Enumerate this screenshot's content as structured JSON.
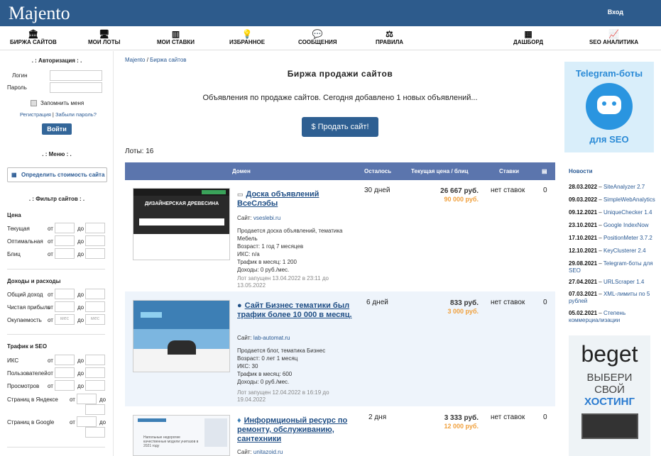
{
  "header": {
    "logo": "Majento",
    "login": "Вход"
  },
  "nav": [
    {
      "icon": "bank-icon",
      "label": "БИРЖА САЙТОВ"
    },
    {
      "icon": "monitor-icon",
      "label": "МОИ ЛОТЫ"
    },
    {
      "icon": "bars-icon",
      "label": "МОИ СТАВКИ"
    },
    {
      "icon": "bulb-icon",
      "label": "ИЗБРАННОЕ"
    },
    {
      "icon": "chat-icon",
      "label": "СООБЩЕНИЯ"
    },
    {
      "icon": "scales-icon",
      "label": "ПРАВИЛА"
    },
    {
      "icon": "grid-icon",
      "label": "ДАШБОРД"
    },
    {
      "icon": "chart-icon",
      "label": "SEO АНАЛИТИКА"
    }
  ],
  "auth": {
    "title": ". : Авторизация : .",
    "login_label": "Логин",
    "pass_label": "Пароль",
    "remember": "Запомнить меня",
    "register": "Регистрация",
    "sep": " | ",
    "forgot": "Забыли пароль?",
    "button": "Войти"
  },
  "menu": {
    "title": ". : Меню : .",
    "calc": "Определить стоимость сайта"
  },
  "filter": {
    "title": ". : Фильтр сайтов : .",
    "price_title": "Цена",
    "price_rows": [
      "Текущая",
      "Оптимальная",
      "Блиц"
    ],
    "from": "от",
    "to": "до",
    "income_title": "Доходы и расходы",
    "income_rows": [
      "Общий доход",
      "Чистая прибыль",
      "Окупаемость"
    ],
    "months": "мес",
    "traffic_title": "Трафик и SEO",
    "traffic_rows": [
      "ИКС",
      "Пользователей",
      "Просмотров"
    ],
    "yandex": "Страниц в Яндексе",
    "google": "Страниц в Google"
  },
  "main": {
    "crumb_home": "Majento",
    "crumb_sep": " / ",
    "crumb_page": "Биржа сайтов",
    "title": "Биржа продажи сайтов",
    "desc": "Объявления по продаже сайтов. Сегодня добавлено 1 новых объявлений...",
    "sell": "$  Продать сайт!",
    "lots": "Лоты: 16",
    "cols": {
      "domain": "Домен",
      "left": "Осталось",
      "price": "Текущая цена / блиц",
      "bids": "Ставки"
    },
    "rows": [
      {
        "title": "Доска объявлений ВсеСлэбы",
        "site_label": "Сайт: ",
        "site": "vseslebi.ru",
        "info": [
          "Продается доска объявлений, тематика Мебель",
          "Возраст: 1 год 7 месяцев",
          "ИКС: n/a",
          "Трафик в месяц: 1 200",
          "Доходы: 0 руб./мес."
        ],
        "time": "Лот запущен 13.04.2022 в 23:11 до 13.05.2022",
        "days": "30 дней",
        "price": "26 667 руб.",
        "blitz": "90 000 руб.",
        "bids": "нет ставок",
        "count": "0",
        "thumb_text": "ДИЗАЙНЕРСКАЯ ДРЕВЕСИНА"
      },
      {
        "title": "Сайт Бизнес тематики был трафик более 10 000 в месяц.",
        "site_label": "Сайт: ",
        "site": "lab-automat.ru",
        "info": [
          "Продается блог, тематика Бизнес",
          "Возраст: 0 лет 1 месяц",
          "ИКС: 30",
          "Трафик в месяц: 600",
          "Доходы: 0 руб./мес."
        ],
        "time": "Лот запущен 12.04.2022 в 16:19 до 19.04.2022",
        "days": "6 дней",
        "price": "833 руб.",
        "blitz": "3 000 руб.",
        "bids": "нет ставок",
        "count": "0",
        "thumb_text": ""
      },
      {
        "title": "Информционый ресурс по ремонту, обслуживанию, сантехники",
        "site_label": "Сайт: ",
        "site": "unitazoid.ru",
        "info": [],
        "time": "",
        "days": "2 дня",
        "price": "3 333 руб.",
        "blitz": "12 000 руб.",
        "bids": "нет ставок",
        "count": "0",
        "thumb_text": "Напольные недорогие качественные модели унитазов в 2021 году"
      }
    ]
  },
  "right": {
    "tg_top": "Telegram-боты",
    "tg_bottom": "для SEO",
    "news_title": "Новости",
    "news": [
      {
        "date": "28.03.2022",
        "text": "SiteAnalyzer 2.7"
      },
      {
        "date": "09.03.2022",
        "text": "SimpleWebAnalytics"
      },
      {
        "date": "09.12.2021",
        "text": "UniqueChecker 1.4"
      },
      {
        "date": "23.10.2021",
        "text": "Google IndexNow"
      },
      {
        "date": "17.10.2021",
        "text": "PositionMeter 3.7.2"
      },
      {
        "date": "12.10.2021",
        "text": "KeyClusterer 2.4"
      },
      {
        "date": "29.08.2021",
        "text": "Telegram-боты для SEO"
      },
      {
        "date": "27.04.2021",
        "text": "URLScraper 1.4"
      },
      {
        "date": "07.03.2021",
        "text": "XML-лимиты по 5 рублей"
      },
      {
        "date": "05.02.2021",
        "text": "Степень коммерциализации"
      }
    ],
    "beget_logo": "beget",
    "beget_l1": "ВЫБЕРИ",
    "beget_l2": "СВОЙ",
    "beget_l3": "ХОСТИНГ"
  }
}
